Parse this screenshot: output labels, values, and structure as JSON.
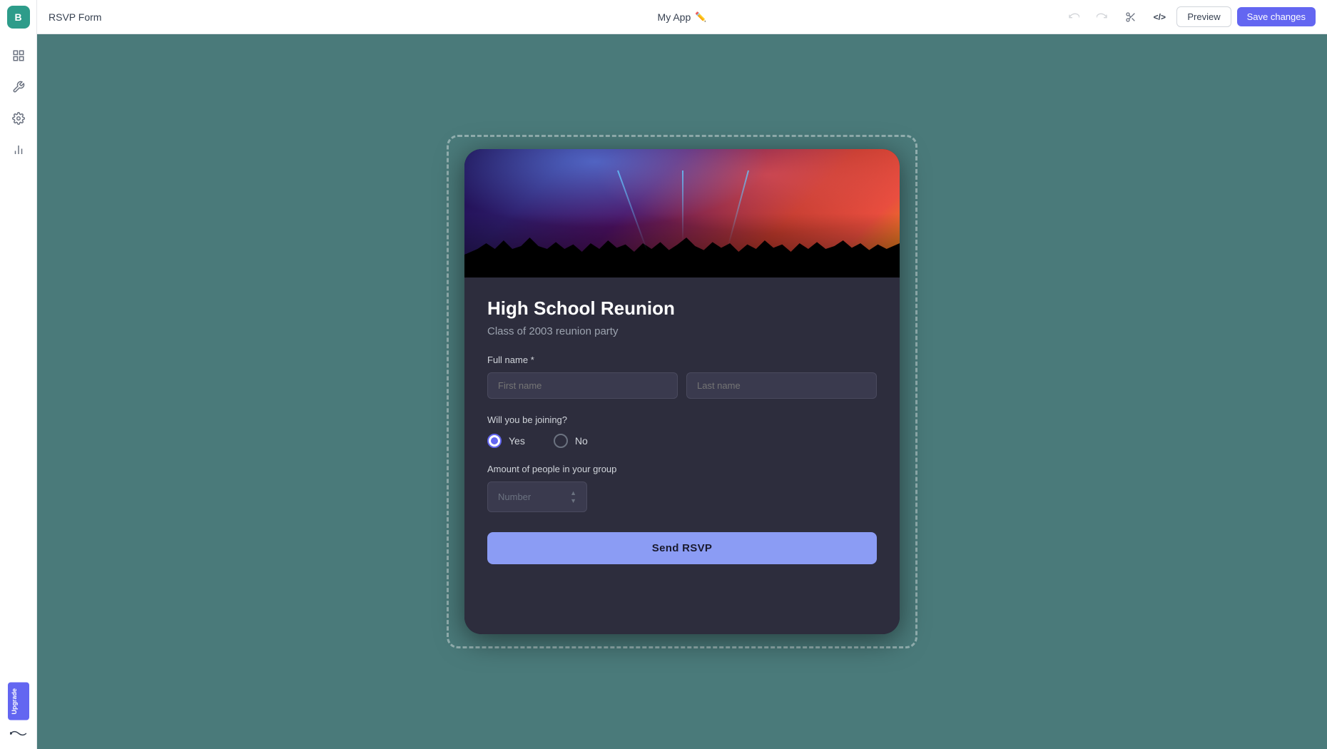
{
  "app": {
    "title": "RSVP Form",
    "name": "My App",
    "edit_icon": "✏️"
  },
  "toolbar": {
    "undo_label": "↩",
    "redo_label": "↪",
    "scissors_label": "✂",
    "code_label": "</>",
    "preview_label": "Preview",
    "save_label": "Save changes"
  },
  "sidebar": {
    "logo": "B",
    "items": [
      {
        "icon": "⊞",
        "name": "grid-icon"
      },
      {
        "icon": "🔧",
        "name": "tools-icon"
      },
      {
        "icon": "⚙",
        "name": "settings-icon"
      },
      {
        "icon": "📊",
        "name": "analytics-icon"
      }
    ],
    "upgrade_label": "Upgrade"
  },
  "form": {
    "title": "High School Reunion",
    "subtitle": "Class of 2003 reunion party",
    "full_name_label": "Full name *",
    "first_name_placeholder": "First name",
    "last_name_placeholder": "Last name",
    "joining_label": "Will you be joining?",
    "yes_label": "Yes",
    "no_label": "No",
    "group_label": "Amount of people in your group",
    "number_placeholder": "Number",
    "send_label": "Send RSVP"
  }
}
